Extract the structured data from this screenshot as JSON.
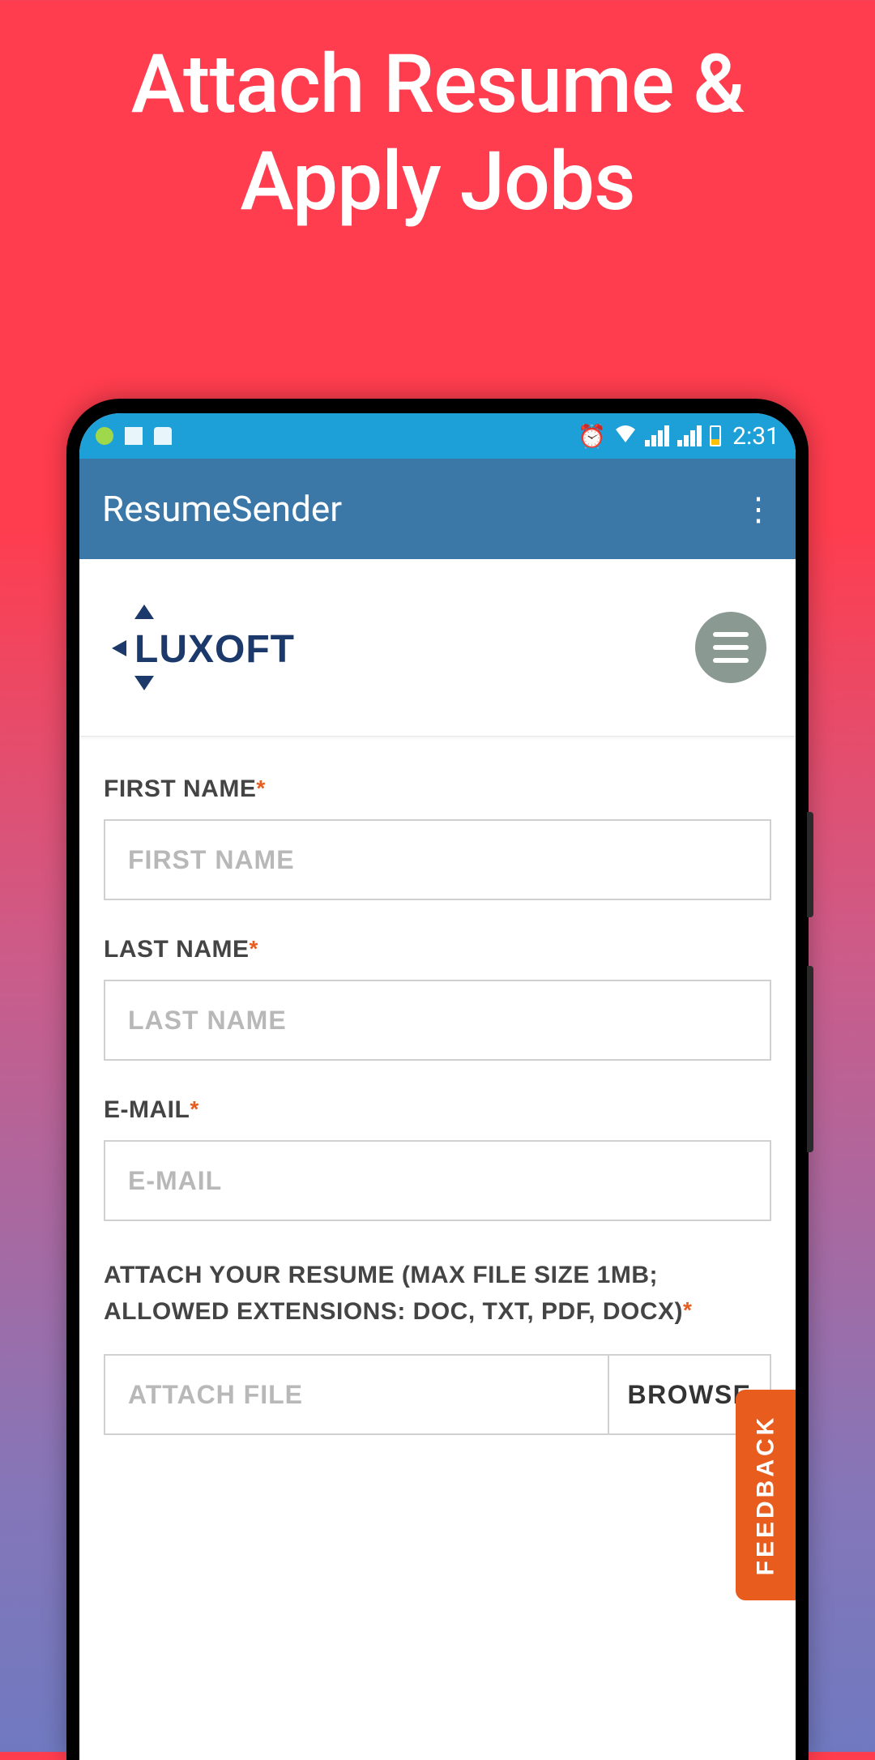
{
  "promo": {
    "title": "Attach Resume & Apply Jobs"
  },
  "status_bar": {
    "time": "2:31"
  },
  "app_bar": {
    "title": "ResumeSender"
  },
  "brand": {
    "name": "LUXOFT"
  },
  "form": {
    "first_name": {
      "label": "FIRST NAME",
      "placeholder": "FIRST NAME",
      "value": ""
    },
    "last_name": {
      "label": "LAST NAME",
      "placeholder": "LAST NAME",
      "value": ""
    },
    "email": {
      "label": "E-MAIL",
      "placeholder": "E-MAIL",
      "value": ""
    },
    "attach": {
      "label": "ATTACH YOUR RESUME (MAX FILE SIZE 1MB; ALLOWED EXTENSIONS: DOC, TXT, PDF, DOCX)",
      "placeholder": "ATTACH FILE",
      "browse_label": "BROWSE"
    }
  },
  "feedback": {
    "label": "FEEDBACK"
  },
  "colors": {
    "accent_orange": "#E85C1E",
    "status_blue": "#1DA0D8",
    "appbar_blue": "#3B78A8",
    "luxoft_navy": "#1B3A6B"
  }
}
